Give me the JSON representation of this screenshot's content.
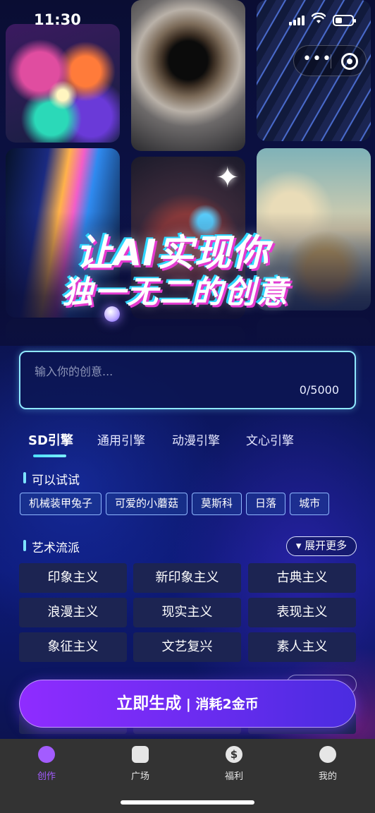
{
  "status_bar": {
    "time": "11:30"
  },
  "hero": {
    "slogan_line1": "让AI实现你",
    "slogan_line2": "独一无二的创意"
  },
  "idea": {
    "placeholder": "输入你的创意...",
    "counter": "0/5000"
  },
  "engine_tabs": [
    {
      "label": "SD引擎",
      "active": true
    },
    {
      "label": "通用引擎",
      "active": false
    },
    {
      "label": "动漫引擎",
      "active": false
    },
    {
      "label": "文心引擎",
      "active": false
    }
  ],
  "try_section": {
    "title": "可以试试",
    "chips": [
      "机械装甲兔子",
      "可爱的小蘑菇",
      "莫斯科",
      "日落",
      "城市"
    ]
  },
  "art_section": {
    "title": "艺术流派",
    "expand_label": "▾ 展开更多",
    "styles": [
      "印象主义",
      "新印象主义",
      "古典主义",
      "浪漫主义",
      "现实主义",
      "表现主义",
      "象征主义",
      "文艺复兴",
      "素人主义"
    ]
  },
  "generate": {
    "label": "立即生成",
    "separator": " | ",
    "cost": "消耗2金币"
  },
  "nav": [
    {
      "label": "创作",
      "icon": "create-icon",
      "active": true
    },
    {
      "label": "广场",
      "icon": "gallery-icon",
      "active": false
    },
    {
      "label": "福利",
      "icon": "dollar-icon",
      "active": false
    },
    {
      "label": "我的",
      "icon": "profile-icon",
      "active": false
    }
  ],
  "colors": {
    "accent": "#a35cff",
    "input_border": "#8fe9ff",
    "tab_underline": "#4ee0ff",
    "button_start": "#8f2cff",
    "button_end": "#4a2ce0"
  }
}
